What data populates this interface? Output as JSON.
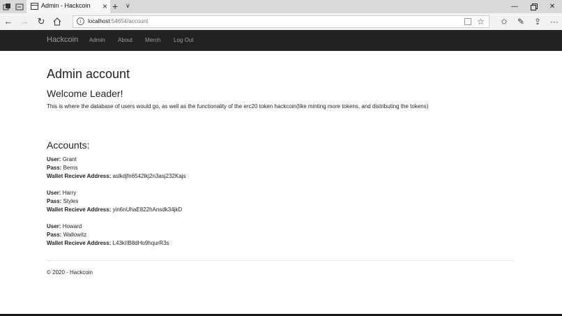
{
  "browser": {
    "tab_title": "Admin - Hackcoin",
    "new_tab_glyph": "+",
    "tab_menu_glyph": "∨",
    "url_host": "localhost",
    "url_rest": ":54654/account",
    "icons": [
      "back-arrow-icon",
      "forward-arrow-icon",
      "refresh-icon",
      "home-icon",
      "info-icon",
      "reading-view-icon",
      "favorite-star-icon",
      "favorites-icon",
      "pen-icon",
      "share-icon",
      "more-icon"
    ]
  },
  "site": {
    "brand": "Hackcoin",
    "nav": [
      "Admin",
      "About",
      "Merch",
      "Log Out"
    ]
  },
  "page": {
    "title": "Admin account",
    "welcome": "Welcome Leader!",
    "intro": "This is where the database of users would go, as well as the functionality of the erc20 token hackcoin(like minting more tokens, and distributing the tokens)",
    "accounts_title": "Accounts:",
    "labels": {
      "user": "User:",
      "pass": "Pass:",
      "wallet": "Wallet Recieve Address:"
    },
    "accounts": [
      {
        "user": "Grant",
        "pass": "Berns",
        "wallet": "aslkdjfn6542lkj2n3asj232Kajs"
      },
      {
        "user": "Harry",
        "pass": "Styles",
        "wallet": "yin6nUhaE822hAnsdk34jkD"
      },
      {
        "user": "Howard",
        "pass": "Wallowitz",
        "wallet": "L43kIIB8dHo9hqurR3s"
      }
    ],
    "footer": "© 2020 - Hackcoin"
  }
}
